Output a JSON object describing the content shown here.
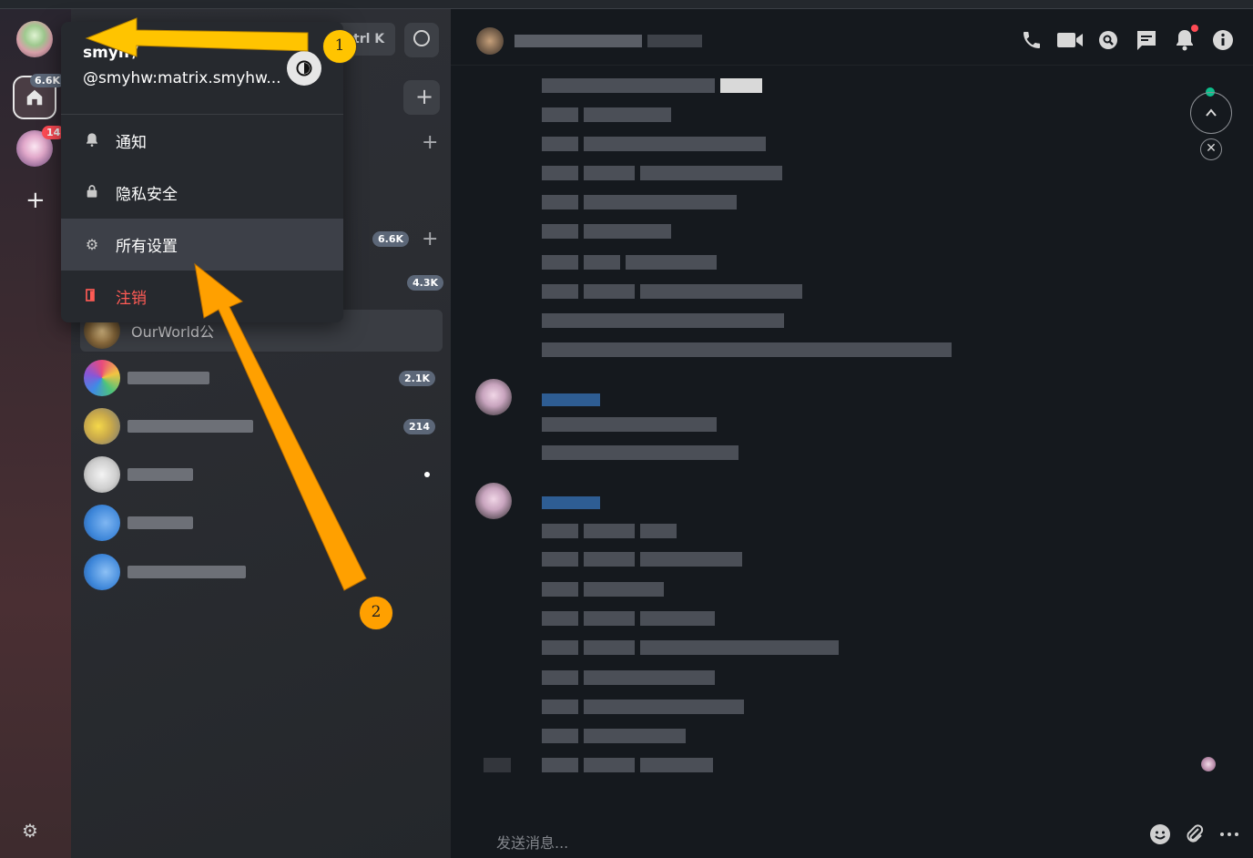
{
  "spacebar": {
    "home_badge": "6.6K",
    "space_badge": "14",
    "add_space": "+"
  },
  "roomlist": {
    "search_shortcut": "trl K",
    "badges": [
      "6.6K",
      "4.3K",
      "2.1K",
      "214"
    ],
    "room_name": "OurWorld公",
    "plus": "+"
  },
  "menu": {
    "display_name": "smyh /",
    "user_id": "@smyhw:matrix.smyhw...",
    "items": [
      {
        "label": "通知",
        "icon": "bell-icon"
      },
      {
        "label": "隐私安全",
        "icon": "lock-icon"
      },
      {
        "label": "所有设置",
        "icon": "gear-icon"
      },
      {
        "label": "注销",
        "icon": "logout-icon"
      }
    ]
  },
  "timeline": {
    "composer_placeholder": "发送消息..."
  },
  "annotations": {
    "callout_1": "1",
    "callout_2": "2"
  },
  "colors": {
    "arrow_1": "#ffc400",
    "arrow_2": "#ffa000",
    "accent_green": "#0dbd8b",
    "danger": "#ff5b55",
    "notification_dot": "#ff4b55"
  }
}
